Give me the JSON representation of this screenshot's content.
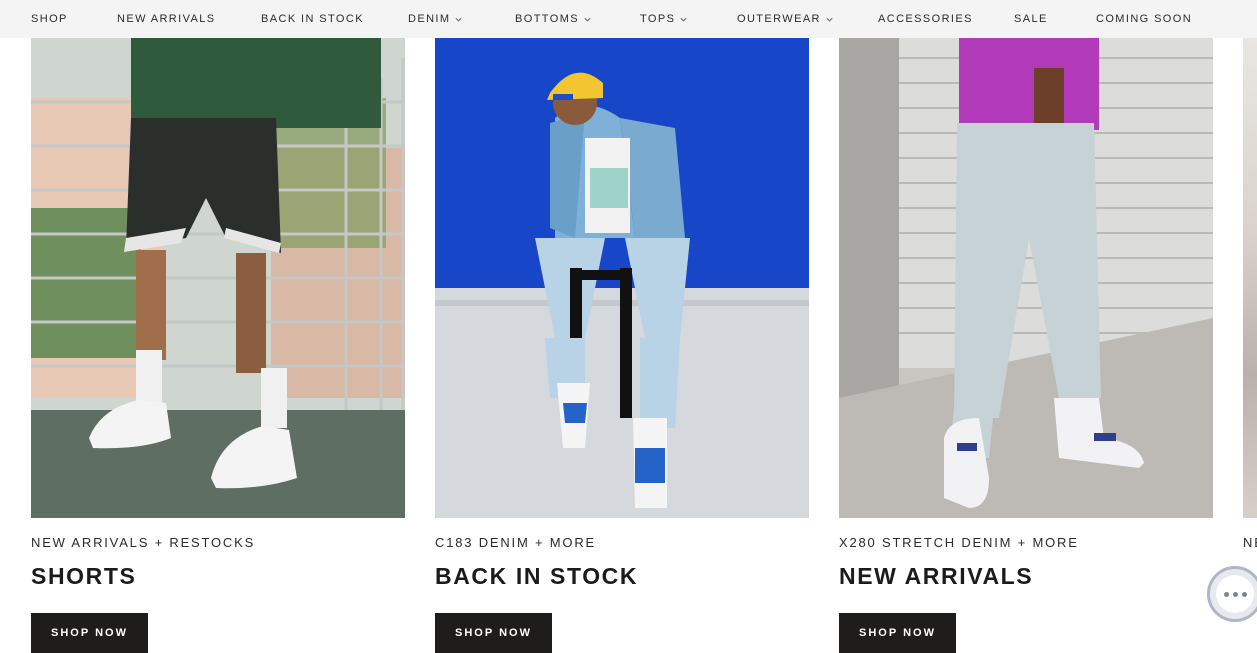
{
  "nav": {
    "items": [
      {
        "label": "SHOP",
        "dropdown": false
      },
      {
        "label": "NEW ARRIVALS",
        "dropdown": false
      },
      {
        "label": "BACK IN STOCK",
        "dropdown": false
      },
      {
        "label": "DENIM",
        "dropdown": true
      },
      {
        "label": "BOTTOMS",
        "dropdown": true
      },
      {
        "label": "TOPS",
        "dropdown": true
      },
      {
        "label": "OUTERWEAR",
        "dropdown": true
      },
      {
        "label": "ACCESSORIES",
        "dropdown": false
      },
      {
        "label": "SALE",
        "dropdown": false
      },
      {
        "label": "COMING SOON",
        "dropdown": false
      }
    ]
  },
  "cards": [
    {
      "eyebrow": "NEW ARRIVALS + RESTOCKS",
      "title": "SHORTS",
      "button": "SHOP NOW"
    },
    {
      "eyebrow": "C183 DENIM + MORE",
      "title": "BACK IN STOCK",
      "button": "SHOP NOW"
    },
    {
      "eyebrow": "X280 STRETCH DENIM + MORE",
      "title": "NEW ARRIVALS",
      "button": "SHOP NOW"
    }
  ],
  "peek_card": {
    "eyebrow_fragment": "NE"
  },
  "chat": {
    "icon": "chat-bubble-icon"
  },
  "colors": {
    "button_bg": "#1f1c1c",
    "nav_bg": "#f4f4f4"
  }
}
